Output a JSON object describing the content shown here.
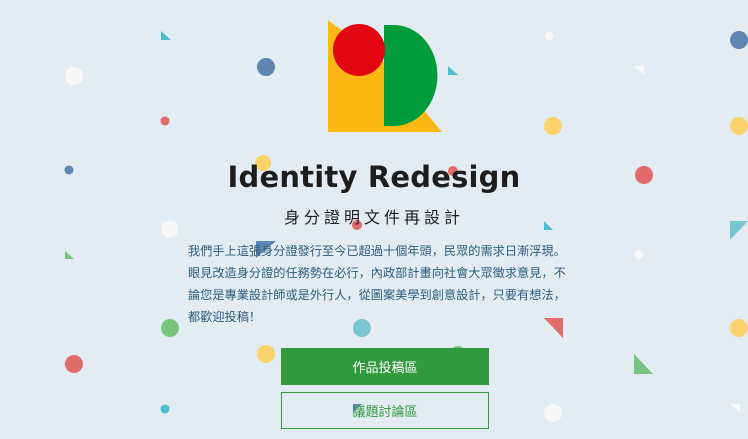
{
  "header": {
    "title": "Identity Redesign",
    "subtitle": "身分證明文件再設計"
  },
  "intro": {
    "text": "我們手上這張身分證發行至今已超過十個年頭，民眾的需求日漸浮現。眼見改造身分證的任務勢在必行，內政部計畫向社會大眾徵求意見，不論您是專業設計師或是外行人，從圖案美學到創意設計，只要有想法，都歡迎投稿！"
  },
  "buttons": {
    "submissions_label": "作品投稿區",
    "discussion_label": "議題討論區"
  },
  "logo": {
    "icon": "ir-logo-icon",
    "colors": {
      "yellow": "#fdb913",
      "red": "#e20613",
      "green": "#009b3a"
    }
  },
  "theme": {
    "background": "#e4ecf3",
    "accent": "#319a3e",
    "intro_text": "#2d5d7b"
  }
}
